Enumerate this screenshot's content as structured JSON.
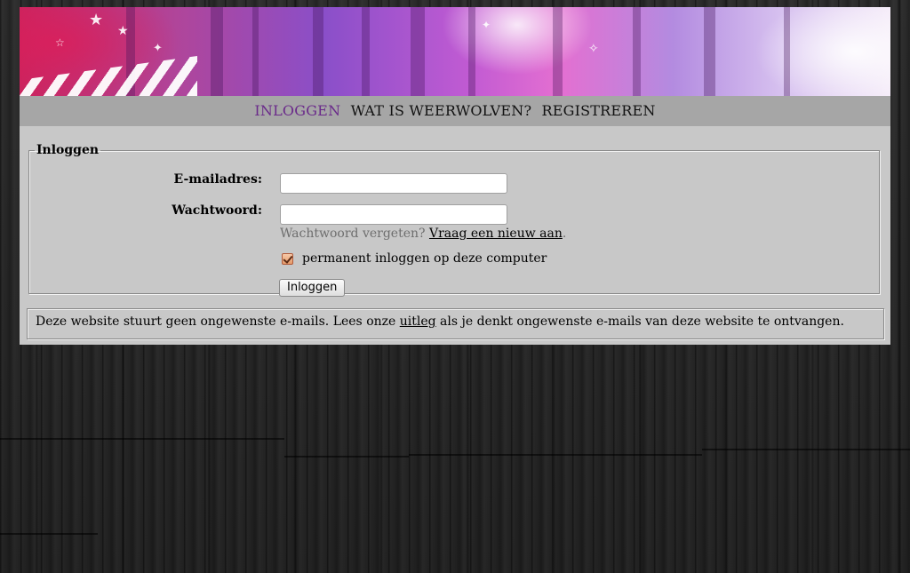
{
  "nav": {
    "items": [
      {
        "label": "INLOGGEN",
        "active": true
      },
      {
        "label": "WAT IS WEERWOLVEN?",
        "active": false
      },
      {
        "label": "REGISTREREN",
        "active": false
      }
    ],
    "active_color": "#6a2a8a"
  },
  "login": {
    "legend": "Inloggen",
    "email_label": "E-mailadres:",
    "email_value": "",
    "password_label": "Wachtwoord:",
    "password_value": "",
    "forgot_text": "Wachtwoord vergeten?",
    "forgot_link": "Vraag een nieuw aan",
    "forgot_suffix": ".",
    "remember_checked": true,
    "remember_label": "permanent inloggen op deze computer",
    "submit_label": "Inloggen"
  },
  "notice": {
    "text_before": "Deze website stuurt geen ongewenste e-mails. Lees onze ",
    "link": "uitleg",
    "text_after": " als je denkt ongewenste e-mails van deze website te ontvangen."
  },
  "icons": {
    "checkbox": "checkmark-icon"
  }
}
